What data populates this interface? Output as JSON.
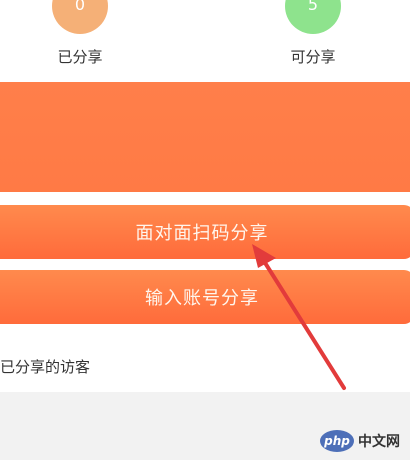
{
  "stats": {
    "shared": {
      "value": "0",
      "label": "已分享",
      "color": "#f5b077"
    },
    "available": {
      "value": "5",
      "label": "可分享",
      "color": "#8ee38d"
    }
  },
  "actions": {
    "face_to_face": "面对面扫码分享",
    "by_account": "输入账号分享"
  },
  "visitors": {
    "title": "已分享的访客"
  },
  "watermark": {
    "logo": "php",
    "text": "中文网"
  },
  "colors": {
    "accent": "#ff7a45",
    "arrow": "#e23b3b"
  }
}
